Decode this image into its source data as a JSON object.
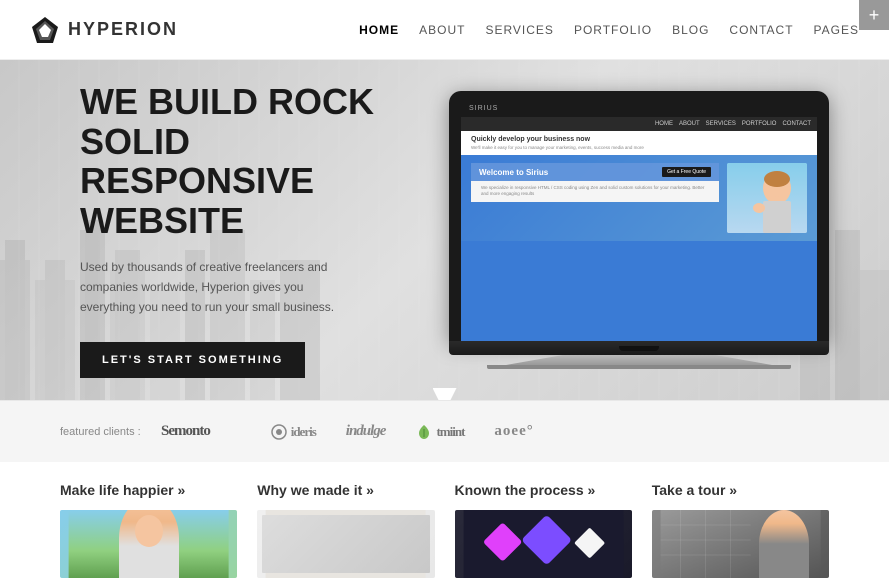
{
  "header": {
    "logo_text": "HYPERION",
    "tab_btn": "+",
    "nav": [
      {
        "label": "HOME",
        "active": true
      },
      {
        "label": "ABOUT",
        "active": false
      },
      {
        "label": "SERVICES",
        "active": false
      },
      {
        "label": "PORTFOLIO",
        "active": false
      },
      {
        "label": "BLOG",
        "active": false
      },
      {
        "label": "CONTACT",
        "active": false
      },
      {
        "label": "PAGES",
        "active": false
      }
    ]
  },
  "hero": {
    "title_line1": "WE BUILD ROCK",
    "title_line2": "SOLID",
    "title_line3": "RESPONSIVE",
    "title_line4": "WEBSITE",
    "subtitle": "Used by thousands of creative freelancers and companies worldwide, Hyperion gives you everything you need to run your small business.",
    "cta_label": "LET'S START SOMETHING",
    "laptop": {
      "brand": "SIRIUS",
      "page_title": "Quickly develop your business now",
      "page_subtitle": "We'll make it easy for you to manage your marketing, events, success media and more",
      "welcome_text": "Welcome to Sirius",
      "cta": "Get a Free Quote",
      "nav_items": [
        "HOME",
        "ABOUT",
        "SERVICES",
        "PORTFOLIO",
        "CONTACT"
      ],
      "bottom_text": "We specialize in responsive HTML / CSS coding using Zen and solid custom solutions for your marketing. Better and more engaging results"
    }
  },
  "clients": {
    "label": "featured clients :",
    "logos": [
      {
        "name": "Semonto",
        "display": "Semonto"
      },
      {
        "name": "ideris",
        "display": "⊙ ideris"
      },
      {
        "name": "indulge",
        "display": "indulge"
      },
      {
        "name": "tmiint",
        "display": "🌿 tmiint"
      },
      {
        "name": "aoee",
        "display": "aoee°"
      }
    ]
  },
  "bottom_cards": [
    {
      "title": "Make life happier »",
      "img_type": "girl"
    },
    {
      "title": "Why we made it »",
      "img_type": "sketch"
    },
    {
      "title": "Known the process »",
      "img_type": "dark"
    },
    {
      "title": "Take a tour »",
      "img_type": "person"
    }
  ]
}
